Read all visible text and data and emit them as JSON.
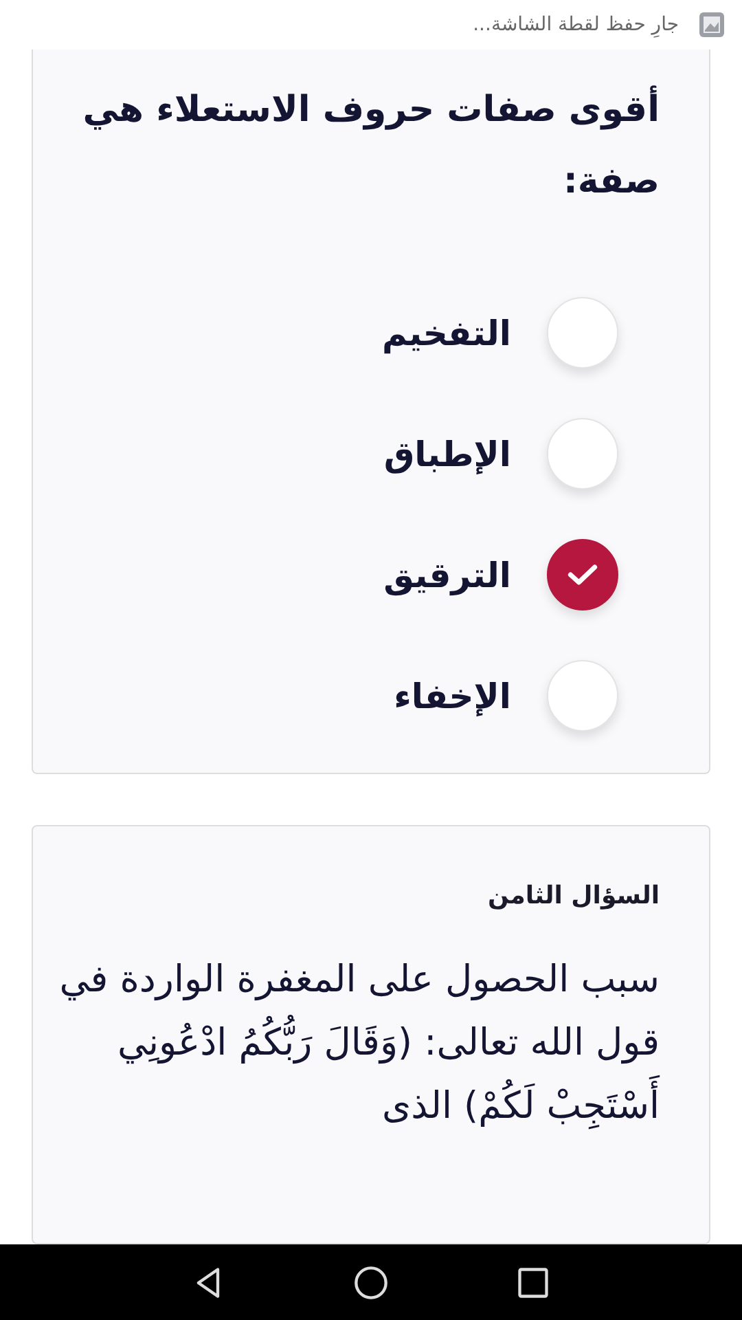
{
  "notification": {
    "text": "جارِ حفظ لقطة الشاشة..."
  },
  "questions": [
    {
      "text": "أقوى صفات حروف الاستعلاء هي صفة:",
      "options": [
        {
          "label": "التفخيم",
          "selected": false
        },
        {
          "label": "الإطباق",
          "selected": false
        },
        {
          "label": "الترقيق",
          "selected": true
        },
        {
          "label": "الإخفاء",
          "selected": false
        }
      ]
    },
    {
      "heading": "السؤال الثامن",
      "text": "سبب الحصول على المغفرة الواردة في قول الله تعالى: (وَقَالَ رَبُّكُمُ ادْعُونِي أَسْتَجِبْ لَكُمْ) الذى"
    }
  ]
}
